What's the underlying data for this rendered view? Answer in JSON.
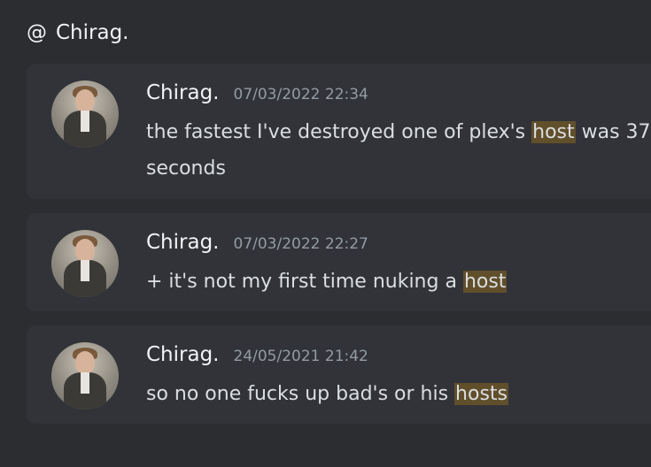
{
  "header": {
    "at_symbol": "@",
    "title": "Chirag."
  },
  "messages": [
    {
      "author": "Chirag.",
      "timestamp": "07/03/2022 22:34",
      "text_before": "the fastest I've destroyed one of plex's ",
      "highlight": "host",
      "text_after": " was 37 seconds"
    },
    {
      "author": "Chirag.",
      "timestamp": "07/03/2022 22:27",
      "text_before": "+ it's not my first time nuking a ",
      "highlight": "host",
      "text_after": ""
    },
    {
      "author": "Chirag.",
      "timestamp": "24/05/2021 21:42",
      "text_before": "so no one fucks up bad's or his ",
      "highlight": "hosts",
      "text_after": ""
    }
  ],
  "colors": {
    "background": "#2b2d31",
    "card": "#313338",
    "highlight": "#614f2b"
  }
}
